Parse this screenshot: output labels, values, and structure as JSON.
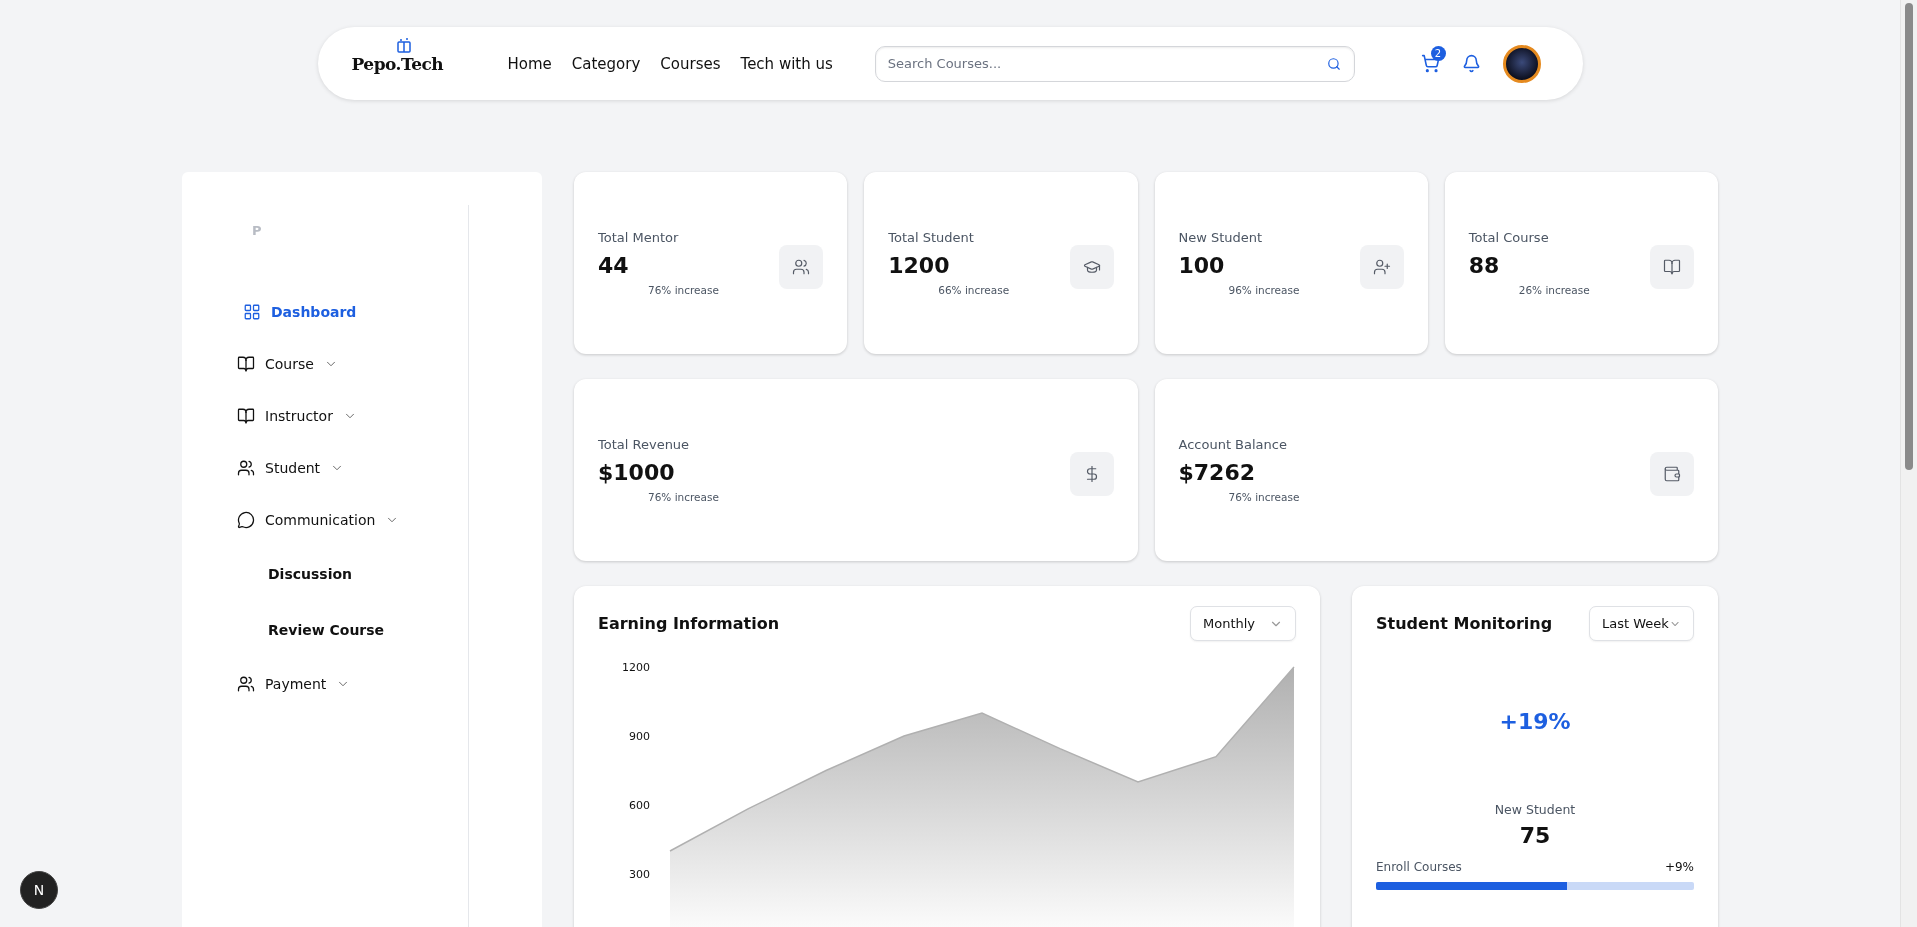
{
  "header": {
    "logo": "Pepo.Tech",
    "nav": [
      {
        "label": "Home"
      },
      {
        "label": "Category"
      },
      {
        "label": "Courses"
      },
      {
        "label": "Tech with us"
      }
    ],
    "search": {
      "placeholder": "Search Courses..."
    },
    "cart_count": "2"
  },
  "sidebar": {
    "logo_letter": "P",
    "items": [
      {
        "label": "Dashboard",
        "kind": "link",
        "selected": true
      },
      {
        "label": "Course",
        "kind": "dropdown",
        "selected": false
      },
      {
        "label": "Instructor",
        "kind": "dropdown",
        "selected": false
      },
      {
        "label": "Student",
        "kind": "dropdown",
        "selected": false
      },
      {
        "label": "Communication",
        "kind": "dropdown",
        "selected": false,
        "children": [
          {
            "label": "Discussion",
            "selected": false
          },
          {
            "label": "Review Course",
            "selected": false
          }
        ]
      },
      {
        "label": "Payment",
        "kind": "dropdown",
        "selected": false
      }
    ]
  },
  "stats": [
    {
      "label": "Total Mentor",
      "value": "44",
      "change": "76% increase"
    },
    {
      "label": "Total Student",
      "value": "1200",
      "change": "66% increase"
    },
    {
      "label": "New Student",
      "value": "100",
      "change": "96% increase"
    },
    {
      "label": "Total Course",
      "value": "88",
      "change": "26% increase"
    }
  ],
  "balances": [
    {
      "label": "Total Revenue",
      "value": "$1000",
      "change": "76% increase"
    },
    {
      "label": "Account Balance",
      "value": "$7262",
      "change": "76% increase"
    }
  ],
  "earning": {
    "title": "Earning Information",
    "period": "Monthly",
    "chart_data": {
      "type": "area",
      "categories": [
        null,
        null,
        null,
        null,
        null,
        null,
        null,
        null,
        null
      ],
      "series": [
        {
          "color": "#b0b0b0",
          "values": [
            400,
            583,
            750,
            900,
            1000,
            845,
            700,
            810,
            1200
          ]
        }
      ],
      "ylim": [
        0,
        1200
      ],
      "yticks": [
        300,
        600,
        900,
        1200
      ]
    }
  },
  "monitoring": {
    "title": "Student Monitoring",
    "period": "Last Week",
    "growth": "+19%",
    "metric_label": "New Student",
    "metric_value": "75",
    "progress": {
      "label": "Enroll Courses",
      "reading": "+9%",
      "level": 0.6
    }
  },
  "dev_badge": "N"
}
